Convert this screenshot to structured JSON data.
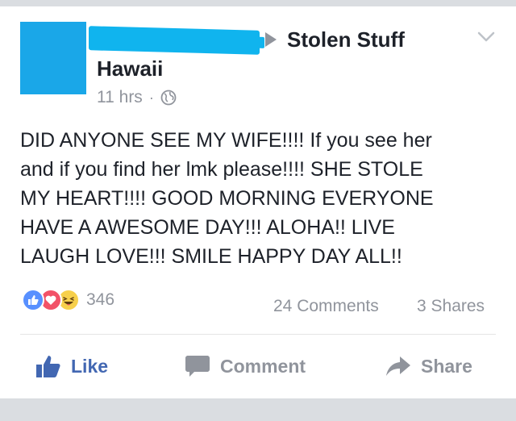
{
  "post": {
    "group_name": "Stolen Stuff",
    "location": "Hawaii",
    "time": "11 hrs",
    "separator": "·",
    "privacy_icon": "globe-icon",
    "text_lines": [
      "DID ANYONE SEE MY WIFE!!!! If you see her",
      "and if you find her lmk please!!!!  SHE STOLE",
      "MY HEART!!!! GOOD MORNING EVERYONE",
      "HAVE A AWESOME DAY!!! ALOHA!! LIVE",
      "LAUGH LOVE!!! SMILE HAPPY DAY ALL!!"
    ]
  },
  "stats": {
    "reactions": [
      "like",
      "love",
      "haha"
    ],
    "reaction_count": "346",
    "comments": "24 Comments",
    "shares": "3 Shares"
  },
  "actions": {
    "like_label": "Like",
    "comment_label": "Comment",
    "share_label": "Share"
  },
  "colors": {
    "avatar": "#1aa7e8",
    "redaction": "#10b4ee",
    "like_blue": "#4267b2",
    "muted": "#90949c",
    "page_band": "#dadde1"
  }
}
